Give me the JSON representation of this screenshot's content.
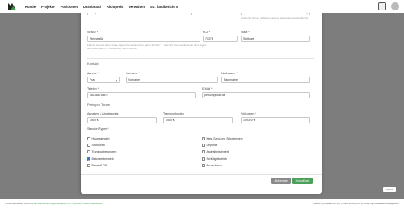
{
  "nav": {
    "items": [
      "Kunde",
      "Projekte",
      "Positionen",
      "Dashboard",
      "Richtpreis",
      "Verwalten",
      "Su: fundbericht's"
    ]
  },
  "modal": {
    "top_field_value": "Beispielsfirmen",
    "top_right_select": "Nein",
    "top_right_help": "Geben Sie hier an, ob Sie ein eigenes oder ein anderes Zeichen ist",
    "strasse_label": "Straße *",
    "strasse_value": "Riegstraße",
    "plz_label": "PLZ *",
    "plz_value": "70376",
    "stadt_label": "Stadt *",
    "stadt_value": "Stuttgart",
    "address_help": "Falls die Adresse keine Straße zugeordnet werden kann, geben Sie bitte ' * ' oder Ihre Geo-Koordinaten in das Längen- und Breitengrad (z.B. 48.8115015, 9.2077652) an.",
    "kontakt_section": "Kontakt",
    "anrede_label": "Anrede *",
    "anrede_value": "Frau",
    "vorname_label": "Vorname *",
    "vorname_value": "Vorname",
    "nachname_label": "Nachname *",
    "nachname_value": "Nachname",
    "telefon_label": "Telefon *",
    "telefon_value": "0815887898 6",
    "email_label": "E-Mail *",
    "email_value": "person@mail.de",
    "preis_section": "Preis pro Tonne",
    "annahme_label": "Annahme / Abgabepreis",
    "annahme_value": "1500 €",
    "transport_label": "Transportkosten",
    "transport_value": "1500 €",
    "vollkosten_label": "Vollkosten *",
    "vollkosten_value": "109320 €",
    "standort_label": "Standort Typen *",
    "types_left": [
      {
        "label": "Hauptstandort",
        "checked": false
      },
      {
        "label": "Standort/n",
        "checked": false
      },
      {
        "label": "Transportbetonwerk",
        "checked": false
      },
      {
        "label": "Betonzentrmwerk",
        "checked": true
      },
      {
        "label": "Baustoff RC",
        "checked": false
      }
    ],
    "types_right": [
      {
        "label": "Kies, Sand und Schotterwerk",
        "checked": false
      },
      {
        "label": "Deponie",
        "checked": false
      },
      {
        "label": "Asphaltmischwerk",
        "checked": false
      },
      {
        "label": "Schüttgutbetrieb",
        "checked": false
      },
      {
        "label": "Zementwerk",
        "checked": false
      }
    ],
    "cancel_label": "Abbrechen",
    "ok_label": "Hinzufügen"
  },
  "footer": {
    "left_text": "© 2024 Marcel Mele GmbH • ",
    "links": "+49 711 222 333 • info@meleplatform.de • Impressum • AGB • Datenschutz",
    "right_text": "Orderbill Sync (Data Test 4/4) | 6.39+0.60.0m4 | ML of Permit: http://localhost:3000/app/sb/30"
  },
  "help_label": "Hilfe?"
}
